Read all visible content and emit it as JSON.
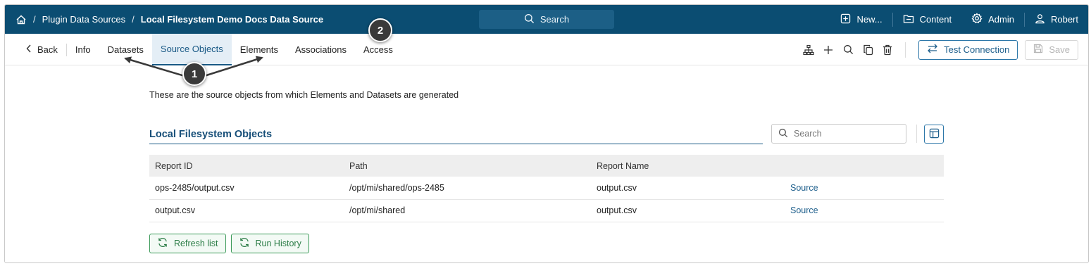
{
  "topbar": {
    "breadcrumbs": [
      "Plugin Data Sources",
      "Local Filesystem Demo Docs Data Source"
    ],
    "search_label": "Search",
    "nav": {
      "new": "New...",
      "content": "Content",
      "admin": "Admin",
      "user": "Robert"
    }
  },
  "subbar": {
    "back": "Back",
    "tabs": [
      "Info",
      "Datasets",
      "Source Objects",
      "Elements",
      "Associations",
      "Access"
    ],
    "active_tab": "Source Objects",
    "test_connection": "Test Connection",
    "save": "Save"
  },
  "main": {
    "intro": "These are the source objects from which Elements and Datasets are generated",
    "section_title": "Local Filesystem Objects",
    "search_placeholder": "Search",
    "table": {
      "columns": [
        "Report ID",
        "Path",
        "Report Name",
        ""
      ],
      "rows": [
        [
          "ops-2485/output.csv",
          "/opt/mi/shared/ops-2485",
          "output.csv",
          "Source"
        ],
        [
          "output.csv",
          "/opt/mi/shared",
          "output.csv",
          "Source"
        ]
      ]
    },
    "buttons": {
      "refresh": "Refresh list",
      "history": "Run History"
    }
  },
  "annotations": {
    "badge1": "1",
    "badge2": "2"
  },
  "colors": {
    "topbar": "#0b4d72",
    "accent": "#1a5a86",
    "green": "#2c7d47",
    "badge": "#3a3a3a"
  }
}
